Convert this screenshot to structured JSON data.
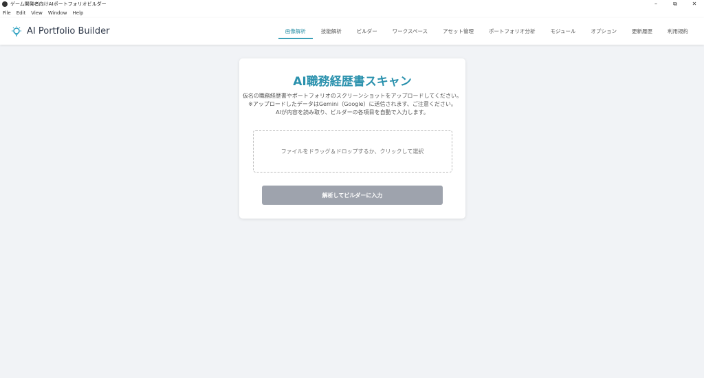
{
  "window": {
    "title": "ゲーム開発者向けAIポートフォリオビルダー",
    "minimize": "–",
    "restore": "⧉",
    "close": "✕"
  },
  "menu": [
    "File",
    "Edit",
    "View",
    "Window",
    "Help"
  ],
  "app": {
    "name": "AI Portfolio Builder",
    "accent": "#2a91ad"
  },
  "nav": [
    "画像解析",
    "技能解析",
    "ビルダー",
    "ワークスペース",
    "アセット管理",
    "ポートフォリオ分析",
    "モジュール",
    "オプション",
    "更新履歴",
    "利用規約"
  ],
  "card": {
    "title": "AI職務経歴書スキャン",
    "desc": [
      "仮名の職務経歴書やポートフォリオのスクリーンショットをアップロードしてください。",
      "※アップロードしたデータはGemini（Google）に送信されます、ご注意ください。",
      "AIが内容を読み取り、ビルダーの各項目を自動で入力します。"
    ],
    "drop": "ファイルをドラッグ＆ドロップするか、クリックして選択",
    "button": "解析してビルダーに入力"
  }
}
